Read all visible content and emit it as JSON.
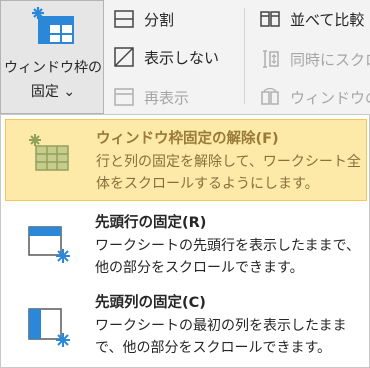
{
  "ribbon": {
    "freeze_button": {
      "line1": "ウィンドウ枠の",
      "line2": "固定 ⌄"
    },
    "split": "分割",
    "hide": "表示しない",
    "unhide": "再表示",
    "side_by_side": "並べて比較",
    "sync_scroll": "同時にスクロ",
    "reset_position": "ウィンドウの"
  },
  "menu": {
    "items": [
      {
        "title": "ウィンドウ枠固定の解除(F)",
        "desc": "行と列の固定を解除して、ワークシート全体をスクロールするようにします。"
      },
      {
        "title": "先頭行の固定(R)",
        "desc": "ワークシートの先頭行を表示したままで、他の部分をスクロールできます。"
      },
      {
        "title": "先頭列の固定(C)",
        "desc": "ワークシートの最初の列を表示したままで、他の部分をスクロールできます。"
      }
    ]
  },
  "colors": {
    "accent_blue": "#2b88d8",
    "highlight": "#fde9a8",
    "highlight_border": "#f2c85b",
    "unfreeze_green": "#93a05a"
  }
}
